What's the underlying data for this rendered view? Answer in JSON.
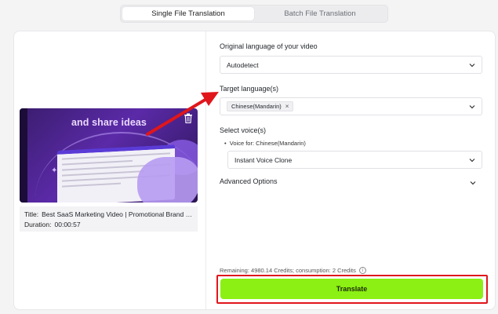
{
  "tabs": [
    {
      "label": "Single File Translation",
      "active": true
    },
    {
      "label": "Batch File Translation",
      "active": false
    }
  ],
  "video": {
    "headline": "and share ideas",
    "title_key": "Title:",
    "title_value": "Best SaaS Marketing Video | Promotional Brand V...",
    "duration_key": "Duration:",
    "duration_value": "00:00:57",
    "delete_icon": "trash-icon"
  },
  "form": {
    "original_label": "Original language of your video",
    "original_value": "Autodetect",
    "target_label": "Target language(s)",
    "target_chip": "Chinese(Mandarin)",
    "voice_label": "Select voice(s)",
    "voice_for": "Voice for: Chinese(Mandarin)",
    "voice_value": "Instant Voice Clone",
    "advanced_label": "Advanced Options"
  },
  "footer": {
    "credits_text": "Remaining: 4980.14 Credits; consumption: 2 Credits",
    "translate_label": "Translate"
  },
  "colors": {
    "accent_button": "#8cf015",
    "annotation_red": "#e0161b"
  }
}
